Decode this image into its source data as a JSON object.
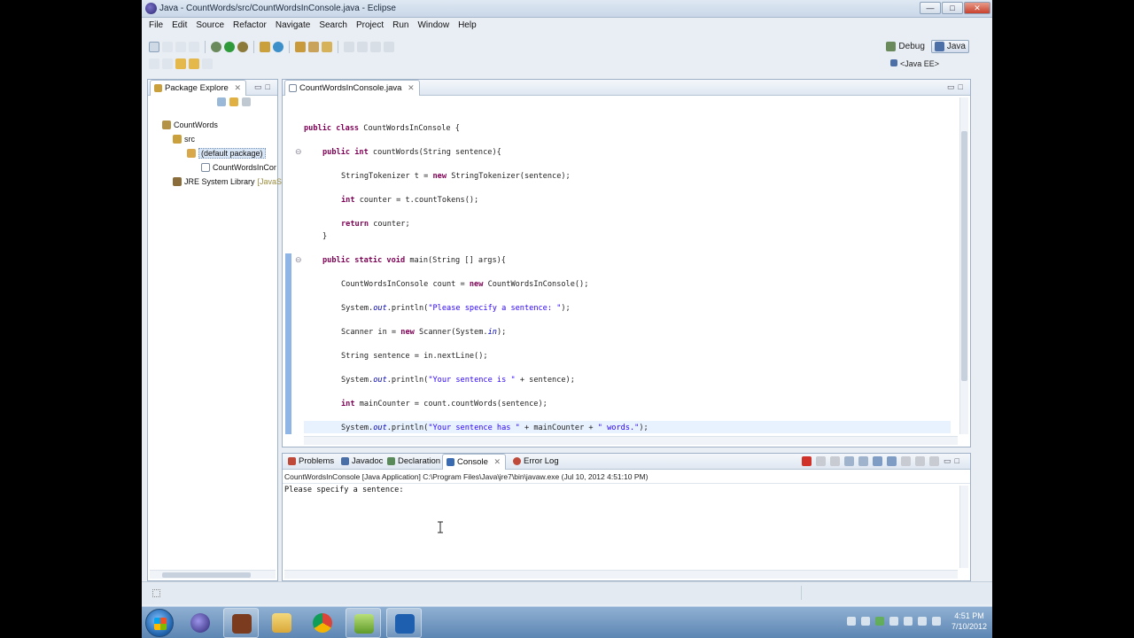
{
  "window": {
    "title": "Java - CountWords/src/CountWordsInConsole.java - Eclipse",
    "minimize": "—",
    "maximize": "□",
    "close": "✕"
  },
  "menu": [
    "File",
    "Edit",
    "Source",
    "Refactor",
    "Navigate",
    "Search",
    "Project",
    "Run",
    "Window",
    "Help"
  ],
  "perspectives": {
    "debug": "Debug",
    "java": "Java",
    "javaee": "<Java EE>"
  },
  "package_explorer": {
    "tab_label": "Package Explore",
    "close": "✕",
    "tree": {
      "project": "CountWords",
      "src": "src",
      "package": "(default package)",
      "file": "CountWordsInCor",
      "jre": "JRE System Library",
      "jre_suffix": "[JavaS"
    }
  },
  "editor": {
    "tab_label": "CountWordsInConsole.java",
    "close": "✕"
  },
  "code": {
    "l1_kw": "public class",
    "l1_rest": " CountWordsInConsole {",
    "l2_kw": "public int",
    "l2_rest": " countWords(String sentence){",
    "l3_a": "StringTokenizer t = ",
    "l3_kw": "new",
    "l3_b": " StringTokenizer(sentence);",
    "l4_kw": "int",
    "l4_rest": " counter = t.countTokens();",
    "l5_kw": "return",
    "l5_rest": " counter;",
    "l6": "}",
    "l7_kw": "public static void",
    "l7_rest": " main(String [] args){",
    "l8_a": "CountWordsInConsole count = ",
    "l8_kw": "new",
    "l8_b": " CountWordsInConsole();",
    "l9_a": "System.",
    "l9_fld": "out",
    "l9_b": ".println(",
    "l9_str": "\"Please specify a sentence: \"",
    "l9_c": ");",
    "l10_a": "Scanner in = ",
    "l10_kw": "new",
    "l10_b": " Scanner(System.",
    "l10_fld": "in",
    "l10_c": ");",
    "l11": "String sentence = in.nextLine();",
    "l12_a": "System.",
    "l12_fld": "out",
    "l12_b": ".println(",
    "l12_str": "\"Your sentence is \"",
    "l12_c": " + sentence);",
    "l13_kw": "int",
    "l13_rest": " mainCounter = count.countWords(sentence);",
    "l14_a": "System.",
    "l14_fld": "out",
    "l14_b": ".println(",
    "l14_str1": "\"Your sentence has \"",
    "l14_c": " + mainCounter + ",
    "l14_str2": "\" words.\"",
    "l14_d": ");"
  },
  "bottom_tabs": {
    "problems": "Problems",
    "javadoc": "Javadoc",
    "declaration": "Declaration",
    "console": "Console",
    "console_close": "✕",
    "errorlog": "Error Log"
  },
  "console": {
    "header": "CountWordsInConsole [Java Application] C:\\Program Files\\Java\\jre7\\bin\\javaw.exe (Jul 10, 2012 4:51:10 PM)",
    "output": "Please specify a sentence: "
  },
  "taskbar": {
    "clock_time": "4:51 PM",
    "clock_date": "7/10/2012"
  },
  "colors": {
    "keyword": "#7f0055",
    "string": "#2a00ff",
    "field": "#0000c0",
    "selection": "#8fb5e6"
  }
}
